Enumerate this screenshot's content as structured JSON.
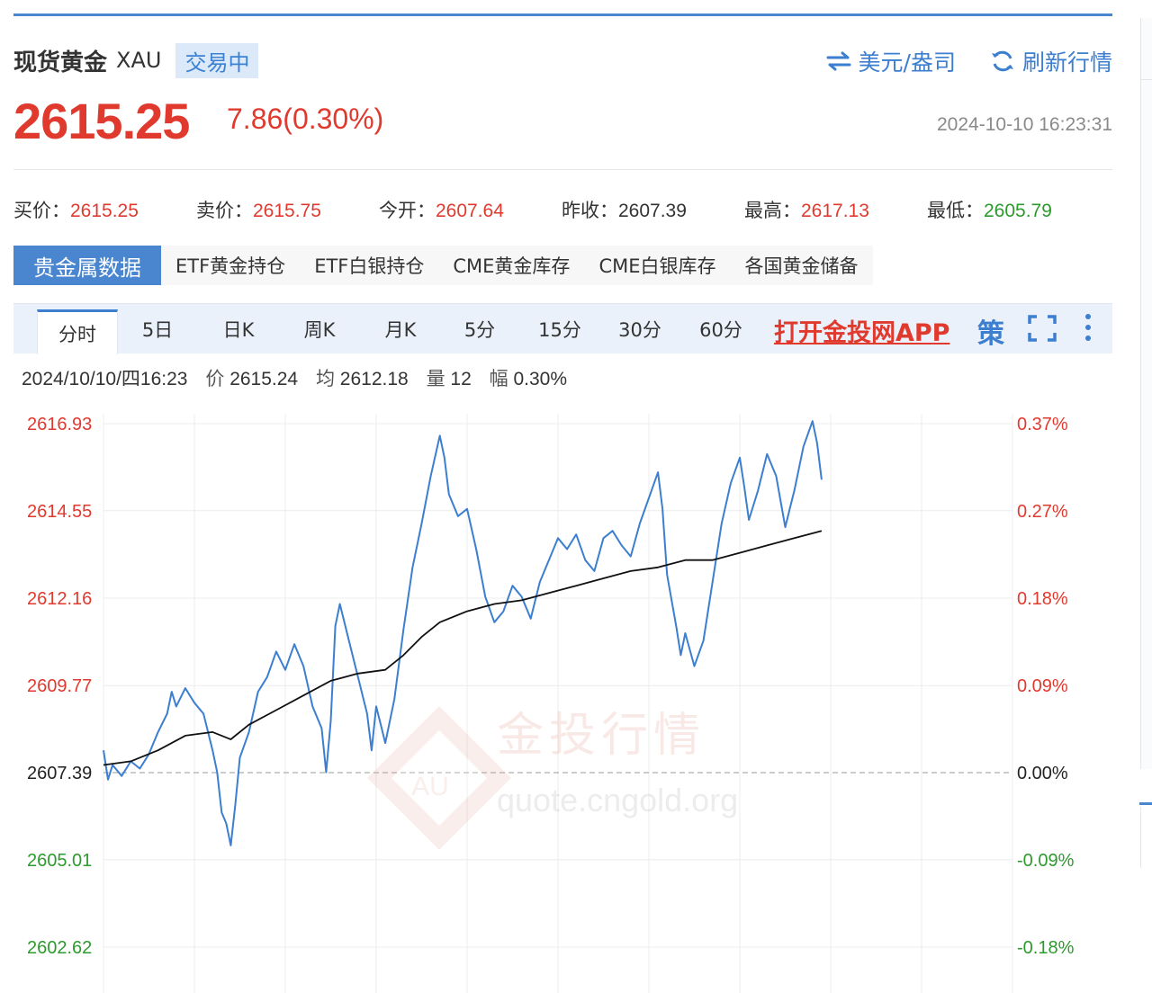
{
  "header": {
    "title": "现货黄金",
    "symbol": "XAU",
    "status": "交易中",
    "unit_toggle": "美元/盎司",
    "refresh": "刷新行情"
  },
  "price": {
    "last": "2615.25",
    "change": "7.86(0.30%)",
    "time": "2024-10-10 16:23:31"
  },
  "quotes": [
    {
      "label": "买价：",
      "value": "2615.25",
      "color": "red"
    },
    {
      "label": "卖价：",
      "value": "2615.75",
      "color": "red"
    },
    {
      "label": "今开：",
      "value": "2607.64",
      "color": "red"
    },
    {
      "label": "昨收：",
      "value": "2607.39",
      "color": "dark"
    },
    {
      "label": "最高：",
      "value": "2617.13",
      "color": "red"
    },
    {
      "label": "最低：",
      "value": "2605.79",
      "color": "green"
    }
  ],
  "tabs": [
    "贵金属数据",
    "ETF黄金持仓",
    "ETF白银持仓",
    "CME黄金库存",
    "CME白银库存",
    "各国黄金储备"
  ],
  "periods": [
    "分时",
    "5日",
    "日K",
    "周K",
    "月K",
    "5分",
    "15分",
    "30分",
    "60分"
  ],
  "toolbar": {
    "app_link": "打开金投网APP",
    "strategy": "策"
  },
  "infobar": {
    "datetime": "2024/10/10/四16:23",
    "price_label": "价",
    "price": "2615.24",
    "avg_label": "均",
    "avg": "2612.18",
    "vol_label": "量",
    "vol": "12",
    "amp_label": "幅",
    "amp": "0.30%"
  },
  "watermark": {
    "cn": "金投行情",
    "url": "quote.cngold.org",
    "badge": "AU"
  },
  "colors": {
    "up": "#e03a2f",
    "down": "#2d9a2d",
    "accent": "#4a86d0",
    "price_line": "#3c7ecf",
    "avg_line": "#111111"
  },
  "chart_data": {
    "type": "line",
    "prev_close": 2607.39,
    "ylim": [
      2602.62,
      2616.93
    ],
    "y_ticks": [
      {
        "price": "2616.93",
        "pct": "0.37%",
        "value": 2616.93
      },
      {
        "price": "2614.55",
        "pct": "0.27%",
        "value": 2614.55
      },
      {
        "price": "2612.16",
        "pct": "0.18%",
        "value": 2612.16
      },
      {
        "price": "2609.77",
        "pct": "0.09%",
        "value": 2609.77
      },
      {
        "price": "2607.39",
        "pct": "0.00%",
        "value": 2607.39
      },
      {
        "price": "2605.01",
        "pct": "-0.09%",
        "value": 2605.01
      },
      {
        "price": "2602.62",
        "pct": "-0.18%",
        "value": 2602.62
      }
    ],
    "x_range": [
      0,
      100
    ],
    "series": [
      {
        "points": [
          [
            0,
            2608.0
          ],
          [
            0.5,
            2607.2
          ],
          [
            1,
            2607.6
          ],
          [
            2,
            2607.3
          ],
          [
            3,
            2607.7
          ],
          [
            4,
            2607.5
          ],
          [
            5,
            2607.9
          ],
          [
            6,
            2608.5
          ],
          [
            7,
            2609.0
          ],
          [
            7.5,
            2609.6
          ],
          [
            8,
            2609.2
          ],
          [
            9,
            2609.7
          ],
          [
            10,
            2609.3
          ],
          [
            11,
            2609.0
          ],
          [
            12,
            2608.0
          ],
          [
            12.5,
            2607.4
          ],
          [
            13,
            2606.3
          ],
          [
            13.5,
            2606.0
          ],
          [
            14,
            2605.4
          ],
          [
            14.5,
            2606.5
          ],
          [
            15,
            2607.8
          ],
          [
            16,
            2608.5
          ],
          [
            17,
            2609.6
          ],
          [
            18,
            2610.0
          ],
          [
            19,
            2610.7
          ],
          [
            20,
            2610.2
          ],
          [
            21,
            2610.9
          ],
          [
            22,
            2610.3
          ],
          [
            23,
            2609.2
          ],
          [
            24,
            2608.6
          ],
          [
            24.5,
            2607.4
          ],
          [
            25,
            2608.8
          ],
          [
            25.5,
            2611.4
          ],
          [
            26,
            2612.0
          ],
          [
            27,
            2611.0
          ],
          [
            28,
            2610.0
          ],
          [
            29,
            2609.0
          ],
          [
            29.5,
            2608.0
          ],
          [
            30,
            2609.2
          ],
          [
            30.5,
            2608.7
          ],
          [
            31,
            2608.2
          ],
          [
            32,
            2609.4
          ],
          [
            33,
            2611.3
          ],
          [
            34,
            2613.0
          ],
          [
            35,
            2614.2
          ],
          [
            36,
            2615.5
          ],
          [
            37,
            2616.6
          ],
          [
            37.5,
            2616.0
          ],
          [
            38,
            2615.0
          ],
          [
            39,
            2614.4
          ],
          [
            40,
            2614.6
          ],
          [
            41,
            2613.5
          ],
          [
            42,
            2612.2
          ],
          [
            43,
            2611.5
          ],
          [
            44,
            2611.8
          ],
          [
            45,
            2612.5
          ],
          [
            46,
            2612.2
          ],
          [
            47,
            2611.6
          ],
          [
            48,
            2612.6
          ],
          [
            49,
            2613.2
          ],
          [
            50,
            2613.8
          ],
          [
            51,
            2613.5
          ],
          [
            52,
            2613.9
          ],
          [
            53,
            2613.2
          ],
          [
            54,
            2612.9
          ],
          [
            55,
            2613.8
          ],
          [
            56,
            2614.0
          ],
          [
            57,
            2613.6
          ],
          [
            58,
            2613.3
          ],
          [
            59,
            2614.2
          ],
          [
            60,
            2614.9
          ],
          [
            61,
            2615.6
          ],
          [
            61.5,
            2614.6
          ],
          [
            62,
            2612.8
          ],
          [
            63,
            2611.4
          ],
          [
            63.5,
            2610.6
          ],
          [
            64,
            2611.2
          ],
          [
            65,
            2610.3
          ],
          [
            66,
            2611.0
          ],
          [
            67,
            2612.6
          ],
          [
            68,
            2614.2
          ],
          [
            69,
            2615.3
          ],
          [
            70,
            2616.0
          ],
          [
            70.5,
            2615.2
          ],
          [
            71,
            2614.3
          ],
          [
            72,
            2615.1
          ],
          [
            73,
            2616.1
          ],
          [
            74,
            2615.5
          ],
          [
            75,
            2614.1
          ],
          [
            75.5,
            2614.6
          ],
          [
            76,
            2615.1
          ],
          [
            77,
            2616.3
          ],
          [
            78,
            2617.0
          ],
          [
            78.5,
            2616.4
          ],
          [
            79,
            2615.4
          ]
        ],
        "color": "#3c7ecf"
      },
      {
        "points": [
          [
            0,
            2607.6
          ],
          [
            3,
            2607.7
          ],
          [
            6,
            2608.0
          ],
          [
            9,
            2608.4
          ],
          [
            12,
            2608.5
          ],
          [
            14,
            2608.3
          ],
          [
            16,
            2608.7
          ],
          [
            19,
            2609.1
          ],
          [
            22,
            2609.5
          ],
          [
            25,
            2609.9
          ],
          [
            28,
            2610.1
          ],
          [
            31,
            2610.2
          ],
          [
            33,
            2610.6
          ],
          [
            35,
            2611.1
          ],
          [
            37,
            2611.5
          ],
          [
            40,
            2611.8
          ],
          [
            43,
            2612.0
          ],
          [
            46,
            2612.1
          ],
          [
            49,
            2612.3
          ],
          [
            52,
            2612.5
          ],
          [
            55,
            2612.7
          ],
          [
            58,
            2612.9
          ],
          [
            61,
            2613.0
          ],
          [
            64,
            2613.2
          ],
          [
            67,
            2613.2
          ],
          [
            70,
            2613.4
          ],
          [
            73,
            2613.6
          ],
          [
            76,
            2613.8
          ],
          [
            79,
            2614.0
          ]
        ],
        "color": "#111111"
      }
    ]
  }
}
